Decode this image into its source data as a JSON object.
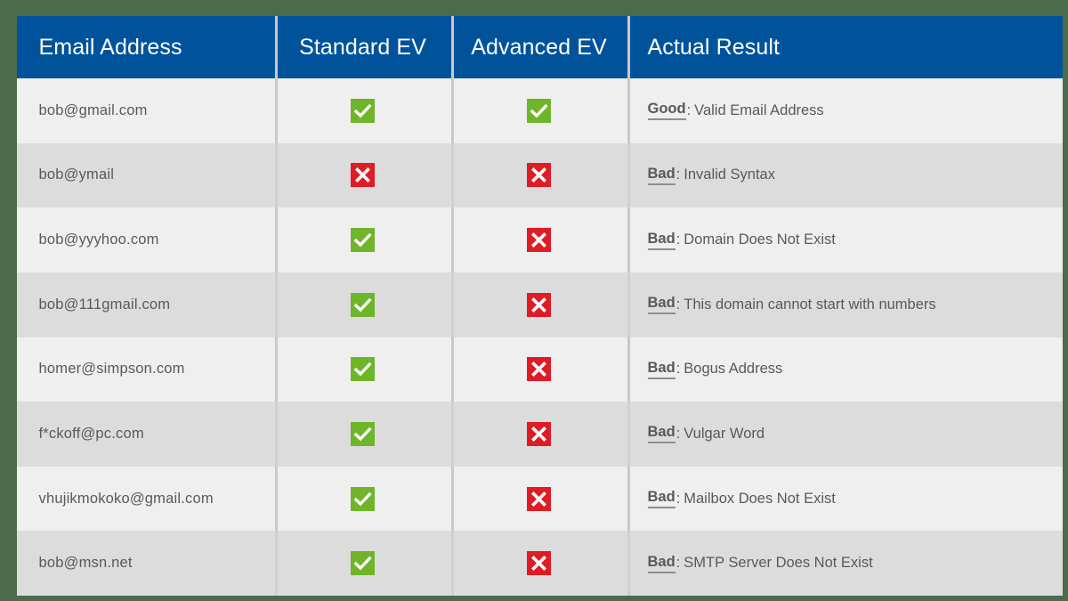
{
  "theme": {
    "page_background": "#4a6c4a",
    "header_background": "#00539b",
    "header_text": "#ffffff",
    "row_odd_background": "#efefef",
    "row_even_background": "#dcdcdc",
    "body_text": "#595959",
    "valid_color": "#6eb52a",
    "invalid_color": "#e01b24",
    "divider_color": "#c9c9c9"
  },
  "table": {
    "columns": [
      {
        "key": "email",
        "label": "Email Address",
        "name": "column-email-address"
      },
      {
        "key": "standard",
        "label": "Standard EV",
        "name": "column-standard-ev"
      },
      {
        "key": "advanced",
        "label": "Advanced EV",
        "name": "column-advanced-ev"
      },
      {
        "key": "result",
        "label": "Actual Result",
        "name": "column-actual-result"
      }
    ],
    "icons": {
      "valid": "green-check-icon",
      "invalid": "red-cross-icon"
    },
    "rows": [
      {
        "email": "bob@gmail.com",
        "standard": "valid",
        "advanced": "valid",
        "verdict": "Good",
        "separator": ":",
        "detail": "Valid Email Address"
      },
      {
        "email": "bob@ymail",
        "standard": "invalid",
        "advanced": "invalid",
        "verdict": "Bad",
        "separator": ":",
        "detail": "Invalid Syntax"
      },
      {
        "email": "bob@yyyhoo.com",
        "standard": "valid",
        "advanced": "invalid",
        "verdict": "Bad",
        "separator": ":",
        "detail": "Domain Does Not Exist"
      },
      {
        "email": "bob@111gmail.com",
        "standard": "valid",
        "advanced": "invalid",
        "verdict": "Bad",
        "separator": ":",
        "detail": "This domain cannot start with numbers"
      },
      {
        "email": "homer@simpson.com",
        "standard": "valid",
        "advanced": "invalid",
        "verdict": "Bad",
        "separator": ":",
        "detail": "Bogus Address"
      },
      {
        "email": "f*ckoff@pc.com",
        "standard": "valid",
        "advanced": "invalid",
        "verdict": "Bad",
        "separator": ":",
        "detail": "Vulgar Word"
      },
      {
        "email": "vhujikmokoko@gmail.com",
        "standard": "valid",
        "advanced": "invalid",
        "verdict": "Bad",
        "separator": ":",
        "detail": "Mailbox Does Not Exist"
      },
      {
        "email": "bob@msn.net",
        "standard": "valid",
        "advanced": "invalid",
        "verdict": "Bad",
        "separator": ":",
        "detail": "SMTP Server Does Not Exist"
      }
    ]
  }
}
